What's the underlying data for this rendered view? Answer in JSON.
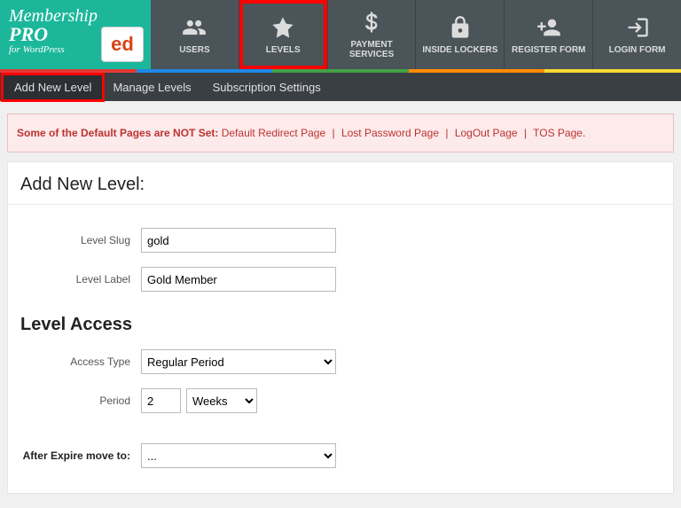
{
  "logo": {
    "title": "Membership",
    "sub": "PRO",
    "wp": "for WordPress",
    "badge": "ed"
  },
  "nav": {
    "users": "USERS",
    "levels": "LEVELS",
    "payment": "PAYMENT SERVICES",
    "lockers": "INSIDE LOCKERS",
    "register": "REGISTER FORM",
    "login": "LOGIN FORM"
  },
  "subnav": {
    "add": "Add New Level",
    "manage": "Manage Levels",
    "subs": "Subscription Settings"
  },
  "alert": {
    "prefix": "Some of the Default Pages are NOT Set: ",
    "links": [
      "Default Redirect Page",
      "Lost Password Page",
      "LogOut Page",
      "TOS Page"
    ],
    "end": "."
  },
  "panel": {
    "title": "Add New Level:",
    "section_access": "Level Access",
    "labels": {
      "slug": "Level Slug",
      "label": "Level Label",
      "access_type": "Access Type",
      "period": "Period",
      "after_expire": "After Expire move to:"
    },
    "values": {
      "slug": "gold",
      "label": "Gold Member",
      "access_type": "Regular Period",
      "period_num": "2",
      "period_unit": "Weeks",
      "after_expire": "..."
    }
  }
}
